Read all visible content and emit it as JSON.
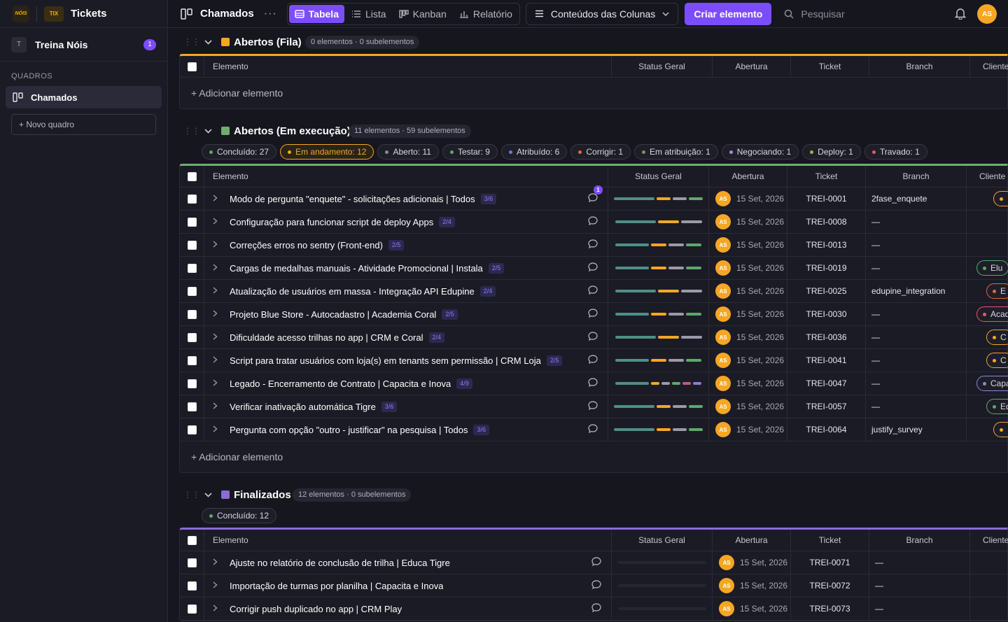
{
  "app": {
    "title": "Tickets",
    "logo_text": "NÓIS",
    "tickets_logo_text": "TIX"
  },
  "sidebar": {
    "workspace_initial": "T",
    "workspace_name": "Treina Nóis",
    "workspace_badge": "1",
    "section_label": "QUADROS",
    "boards": [
      {
        "label": "Chamados"
      }
    ],
    "new_board_label": "+ Novo quadro"
  },
  "topbar": {
    "board_title": "Chamados",
    "more": "···",
    "views": [
      {
        "label": "Tabela",
        "icon": "table-icon",
        "active": true
      },
      {
        "label": "Lista",
        "icon": "list-icon"
      },
      {
        "label": "Kanban",
        "icon": "kanban-icon"
      },
      {
        "label": "Relatório",
        "icon": "chart-icon"
      }
    ],
    "columns_button": "Conteúdos das Colunas",
    "create_button": "Criar elemento",
    "search_placeholder": "Pesquisar",
    "user_initials": "AS"
  },
  "columns": {
    "element": "Elemento",
    "status": "Status Geral",
    "opened": "Abertura",
    "ticket": "Ticket",
    "branch": "Branch",
    "client": "Cliente"
  },
  "add_element": "+ Adicionar elemento",
  "colors": {
    "accent": "#7c4dff",
    "queue": "#f5a623",
    "running": "#6fae6f",
    "done": "#8b6bd6",
    "avatar": "#f5a623"
  },
  "groups": [
    {
      "title": "Abertos (Fila)",
      "count": "0 elementos · 0 subelementos",
      "rows": []
    },
    {
      "title": "Abertos (Em execução)",
      "count": "11 elementos · 59 subelementos",
      "chips": [
        {
          "label": "Concluído: 27",
          "color": "#5fa86a"
        },
        {
          "label": "Em andamento: 12",
          "color": "#f5a623",
          "active": true
        },
        {
          "label": "Aberto: 11",
          "color": "#8a8a96"
        },
        {
          "label": "Testar: 9",
          "color": "#5fa86a"
        },
        {
          "label": "Atribuído: 6",
          "color": "#6a7bd6"
        },
        {
          "label": "Corrigir: 1",
          "color": "#e06a3a"
        },
        {
          "label": "Em atribuição: 1",
          "color": "#8a8a60"
        },
        {
          "label": "Negociando: 1",
          "color": "#b08ad6"
        },
        {
          "label": "Deploy: 1",
          "color": "#a0b050"
        },
        {
          "label": "Travado: 1",
          "color": "#e05a6a"
        }
      ],
      "rows": [
        {
          "title": "Modo de pergunta \"enquete\" - solicitações adicionais | Todos",
          "sub": "3/6",
          "comments": "1",
          "date": "15 Set, 2026",
          "ticket": "TREI-0001",
          "branch": "2fase_enquete",
          "client": "",
          "client_color": "#f5a623"
        },
        {
          "title": "Configuração para funcionar script de deploy Apps",
          "sub": "2/4",
          "date": "15 Set, 2026",
          "ticket": "TREI-0008",
          "branch": "—",
          "client": "",
          "client_color": ""
        },
        {
          "title": "Correções erros no sentry (Front-end)",
          "sub": "2/5",
          "date": "15 Set, 2026",
          "ticket": "TREI-0013",
          "branch": "—",
          "client": "",
          "client_color": ""
        },
        {
          "title": "Cargas de medalhas manuais - Atividade Promocional | Instala",
          "sub": "2/5",
          "date": "15 Set, 2026",
          "ticket": "TREI-0019",
          "branch": "—",
          "client": "Elu",
          "client_color": "#5fa86a"
        },
        {
          "title": "Atualização de usuários em massa - Integração API Edupine",
          "sub": "2/4",
          "date": "15 Set, 2026",
          "ticket": "TREI-0025",
          "branch": "edupine_integration",
          "client": "E",
          "client_color": "#e06a3a"
        },
        {
          "title": "Projeto Blue Store - Autocadastro | Academia Coral",
          "sub": "2/5",
          "date": "15 Set, 2026",
          "ticket": "TREI-0030",
          "branch": "—",
          "client": "Acad",
          "client_color": "#e05a6a"
        },
        {
          "title": "Dificuldade acesso trilhas no app | CRM e Coral",
          "sub": "2/4",
          "date": "15 Set, 2026",
          "ticket": "TREI-0036",
          "branch": "—",
          "client": "C",
          "client_color": "#f5a623"
        },
        {
          "title": "Script para tratar usuários com loja(s) em tenants sem permissão | CRM Loja",
          "sub": "2/5",
          "date": "15 Set, 2026",
          "ticket": "TREI-0041",
          "branch": "—",
          "client": "C",
          "client_color": "#f5a623"
        },
        {
          "title": "Legado - Encerramento de Contrato | Capacita e Inova",
          "sub": "4/9",
          "date": "15 Set, 2026",
          "ticket": "TREI-0047",
          "branch": "—",
          "client": "Capa",
          "client_color": "#8a8ad6"
        },
        {
          "title": "Verificar inativação automática Tigre",
          "sub": "3/6",
          "date": "15 Set, 2026",
          "ticket": "TREI-0057",
          "branch": "—",
          "client": "Ed",
          "client_color": "#5fa86a"
        },
        {
          "title": "Pergunta com opção \"outro - justificar\" na pesquisa | Todos",
          "sub": "3/6",
          "date": "15 Set, 2026",
          "ticket": "TREI-0064",
          "branch": "justify_survey",
          "client": "",
          "client_color": "#f5a623"
        }
      ]
    },
    {
      "title": "Finalizados",
      "count": "12 elementos · 0 subelementos",
      "chips": [
        {
          "label": "Concluído: 12",
          "color": "#5fa86a"
        }
      ],
      "rows": [
        {
          "title": "Ajuste no relatório de conclusão de trilha | Educa Tigre",
          "date": "15 Set, 2026",
          "ticket": "TREI-0071",
          "branch": "—"
        },
        {
          "title": "Importação de turmas por planilha | Capacita e Inova",
          "date": "15 Set, 2026",
          "ticket": "TREI-0072",
          "branch": "—"
        },
        {
          "title": "Corrigir push duplicado no app | CRM Play",
          "date": "15 Set, 2026",
          "ticket": "TREI-0073",
          "branch": "—"
        }
      ]
    }
  ]
}
